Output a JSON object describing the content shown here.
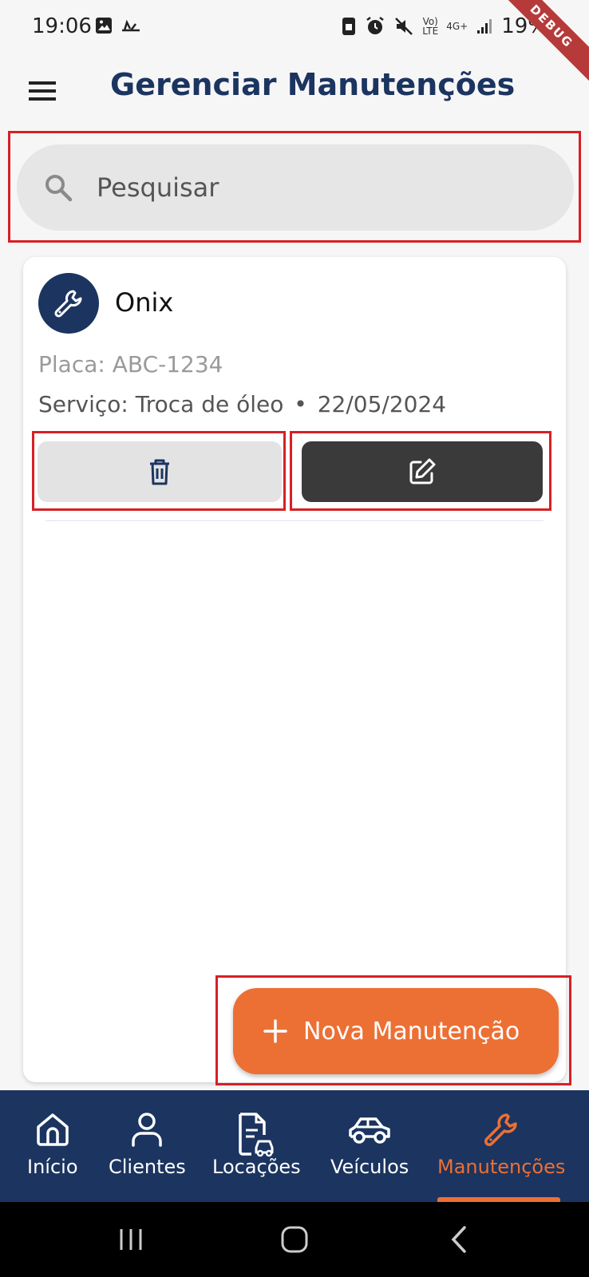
{
  "status": {
    "time": "19:06",
    "battery": "19%",
    "volte": "Vo)\nLTE",
    "network": "4G+",
    "debug": "DEBUG"
  },
  "header": {
    "title": "Gerenciar Manutenções"
  },
  "search": {
    "placeholder": "Pesquisar",
    "value": ""
  },
  "maintenance": {
    "name": "Onix",
    "plate": "Placa: ABC-1234",
    "service": "Serviço: Troca de óleo",
    "separator": "•",
    "date": "22/05/2024"
  },
  "fab": {
    "label": "Nova Manutenção"
  },
  "nav": {
    "items": [
      {
        "label": "Início",
        "icon": "home-icon"
      },
      {
        "label": "Clientes",
        "icon": "person-icon"
      },
      {
        "label": "Locações",
        "icon": "rental-icon"
      },
      {
        "label": "Veículos",
        "icon": "car-icon"
      },
      {
        "label": "Manutenções",
        "icon": "wrench-icon"
      }
    ],
    "active_index": 4
  },
  "colors": {
    "primary": "#1b3560",
    "accent": "#ec6f33",
    "highlight": "#d81f26",
    "edit_button": "#3a3a3a",
    "delete_button": "#e3e3e3"
  }
}
